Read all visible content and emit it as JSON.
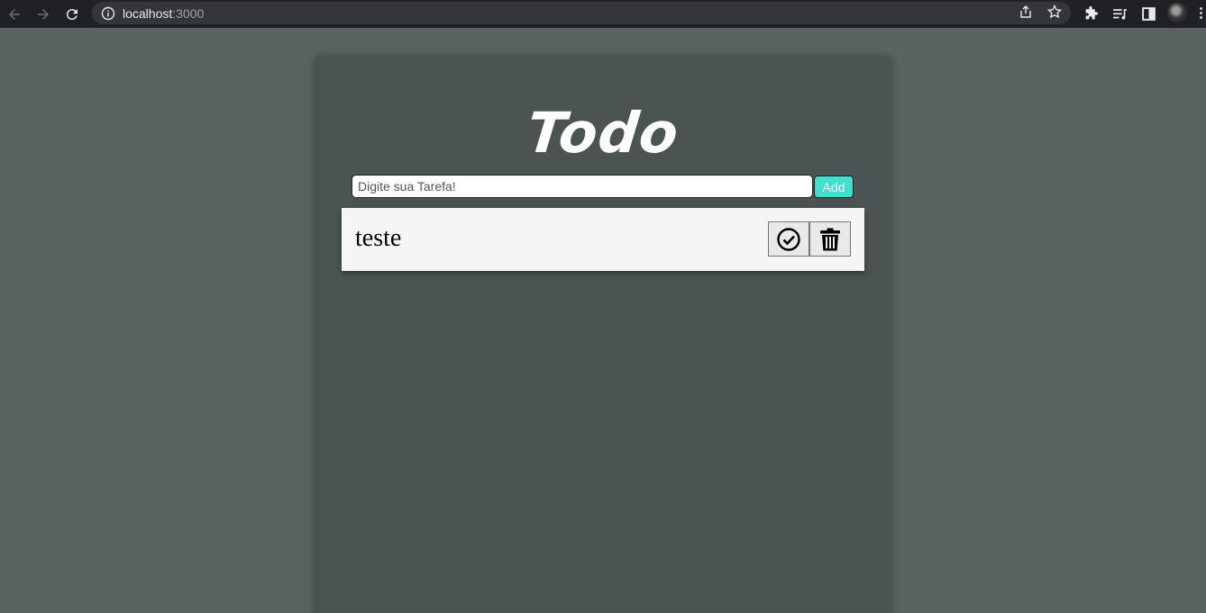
{
  "browser": {
    "url_host": "localhost",
    "url_port": ":3000",
    "icons": [
      "back-arrow-icon",
      "forward-arrow-icon",
      "reload-icon",
      "info-icon",
      "share-icon",
      "star-icon",
      "extensions-icon",
      "media-icon",
      "side-panel-icon",
      "profile-avatar",
      "more-menu-icon"
    ]
  },
  "app": {
    "title": "Todo",
    "input_placeholder": "Digite sua Tarefa!",
    "input_value": "",
    "add_label": "Add",
    "colors": {
      "page_bg": "#5a6360",
      "card_bg": "#4b5452",
      "add_button": "#3fe0cc",
      "item_bg": "#f5f5f5"
    },
    "todos": [
      {
        "text": "teste",
        "actions": [
          "check-circle-icon",
          "trash-icon"
        ]
      }
    ]
  }
}
